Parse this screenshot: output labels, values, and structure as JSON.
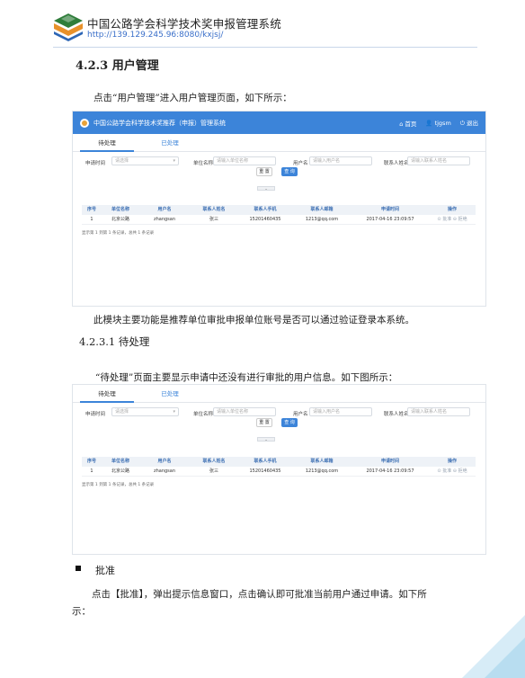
{
  "header": {
    "org_name": "中国公路学会科学技术奖申报管理系统",
    "url": "http://139.129.245.96:8080/kxjsj/"
  },
  "section": {
    "title": "4.2.3 用户管理",
    "intro": "点击“用户管理”进入用户管理页面，如下所示：",
    "module_desc": "此模块主要功能是推荐单位审批申报单位账号是否可以通过验证登录本系统。",
    "sub_title": "4.2.3.1 待处理",
    "sub_desc": "“待处理”页面主要显示申请中还没有进行审批的用户信息。如下图所示：",
    "bullet_label": "批准",
    "approve_line1": "点击【批准】，弹出提示信息窗口，点击确认即可批准当前用户通过申请。如下所",
    "approve_line2": "示："
  },
  "app": {
    "title": "中国公路学会科学技术奖推荐（申报）管理系统",
    "nav_home": "首页",
    "nav_user": "tjgsm",
    "nav_logout": "退出",
    "tab_pending": "待处理",
    "tab_done": "已处理",
    "filters": {
      "time_label": "申请时间",
      "time_placeholder": "请选择",
      "unit_label": "单位名称",
      "unit_placeholder": "请输入单位名称",
      "user_label": "用户名",
      "user_placeholder": "请输入用户名",
      "contact_label": "联系人姓名",
      "contact_placeholder": "请输入联系人姓名",
      "reset": "重 置",
      "search": "查 询"
    },
    "table": {
      "headers": [
        "序号",
        "单位名称",
        "用户名",
        "联系人姓名",
        "联系人手机",
        "联系人邮箱",
        "申请时间",
        "操作"
      ],
      "rows": [
        [
          "1",
          "北京公路",
          "zhangsan",
          "张三",
          "15201460435",
          "1213@qq.com",
          "2017-04-16 23:09:57"
        ]
      ],
      "action_approve": "批准",
      "action_reject": "拒绝"
    },
    "pagination": "显示第 1 到第 1 条记录，总共 1 条记录"
  },
  "colors": {
    "accent": "#3c84d9",
    "url": "#3a6fc9"
  }
}
